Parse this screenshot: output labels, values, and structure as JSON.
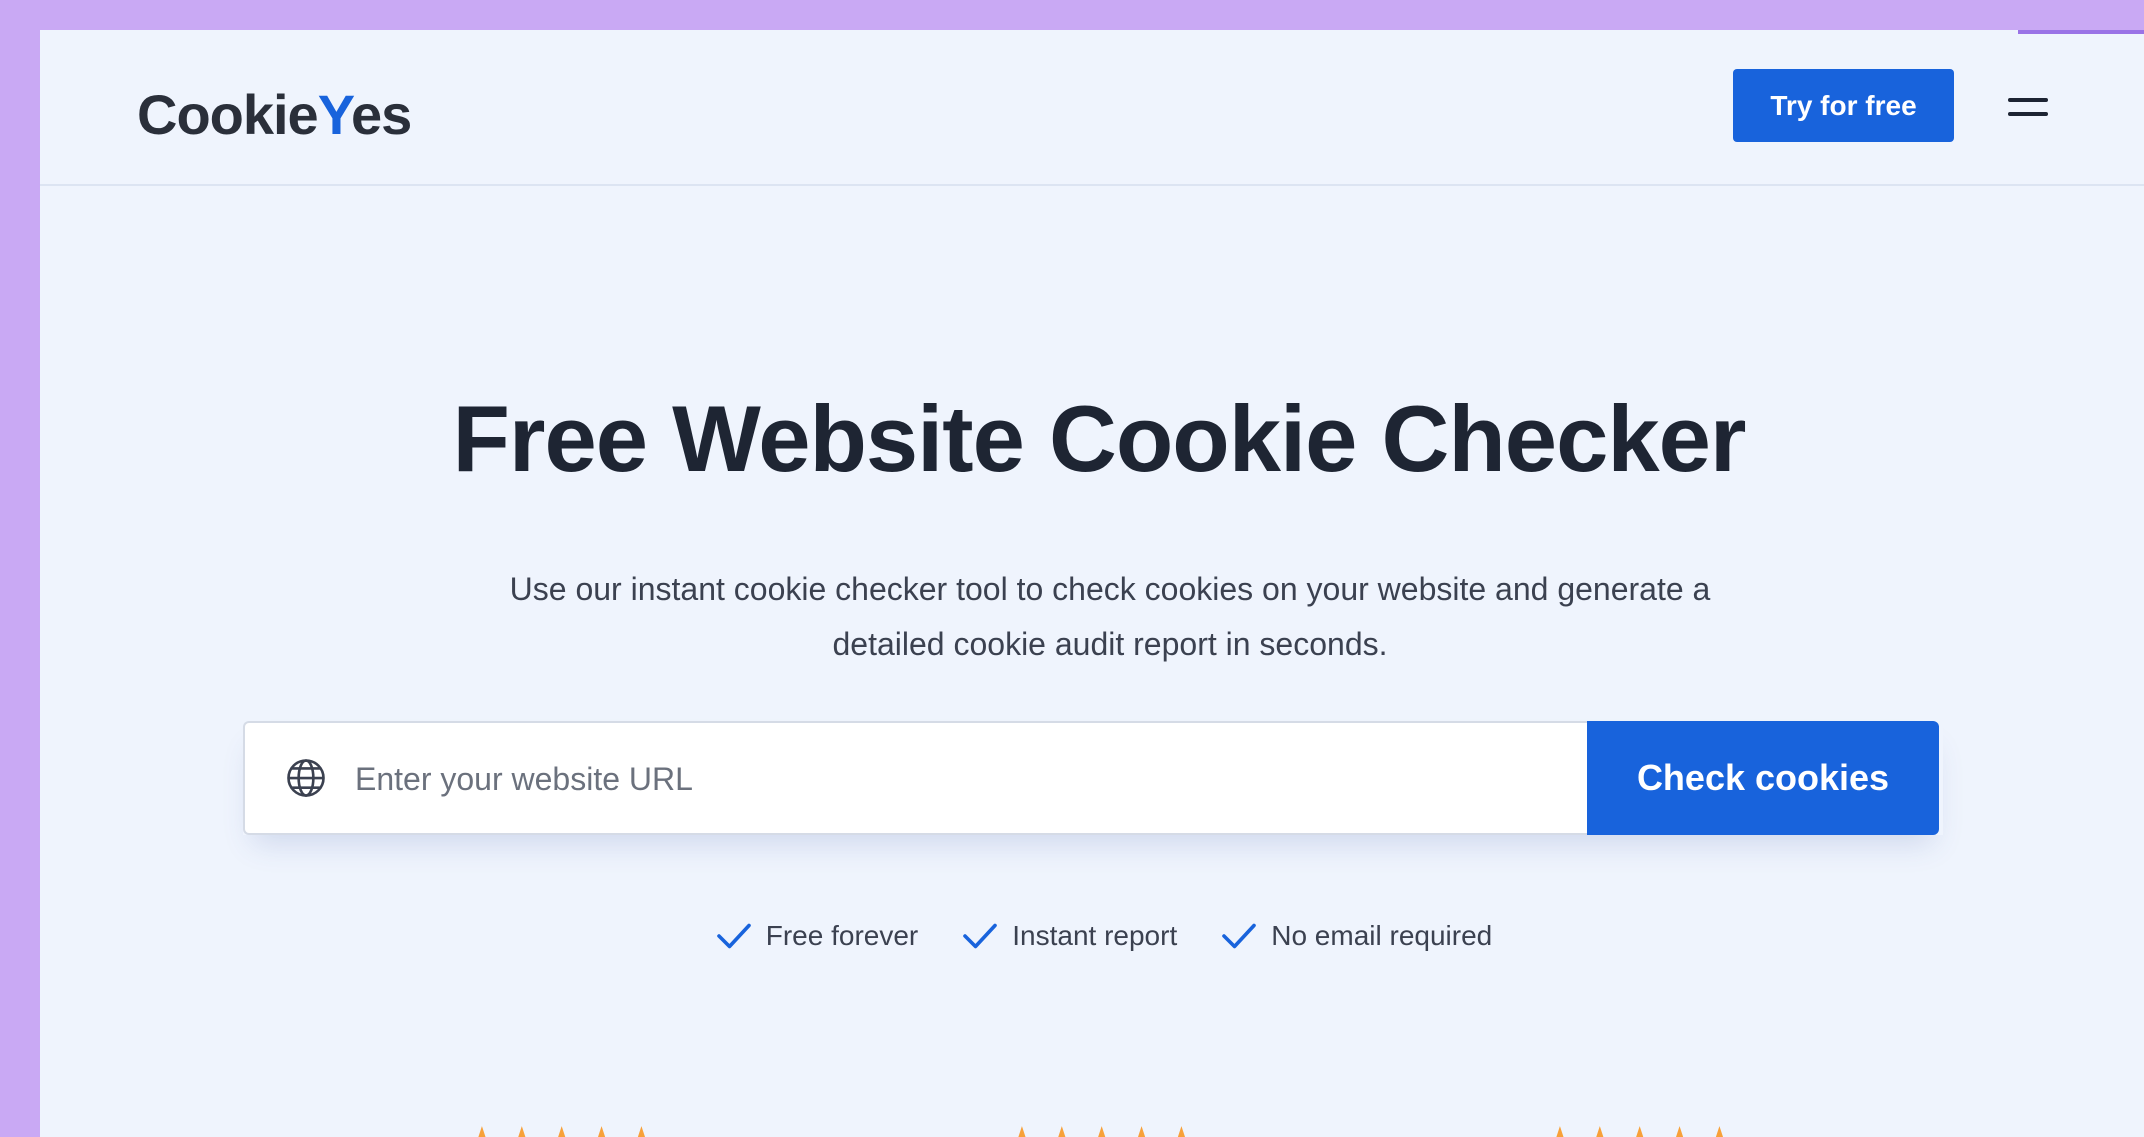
{
  "header": {
    "logo_text_a": "Cookie",
    "logo_text_y": "Y",
    "logo_text_b": "es",
    "try_button": "Try for free"
  },
  "hero": {
    "title": "Free Website Cookie Checker",
    "subtitle_line1": "Use our instant cookie checker tool to check cookies on your website and generate a",
    "subtitle_line2": "detailed cookie audit report in seconds."
  },
  "search": {
    "placeholder": "Enter your website URL",
    "value": "",
    "button": "Check cookies"
  },
  "features": [
    {
      "label": "Free forever"
    },
    {
      "label": "Instant report"
    },
    {
      "label": "No email required"
    }
  ],
  "ratings": [
    {
      "platform_icon": "g2-icon",
      "stars": "★★★★★"
    },
    {
      "platform_icon": "capterra-icon",
      "stars": "★★★★★"
    },
    {
      "platform_icon": "wordpress-icon",
      "stars": "★★★★★"
    }
  ],
  "colors": {
    "accent": "#1863dc",
    "background": "#eff4fd",
    "frame": "#c9a9f4",
    "star": "#f7a13a",
    "heading": "#1e2533"
  }
}
